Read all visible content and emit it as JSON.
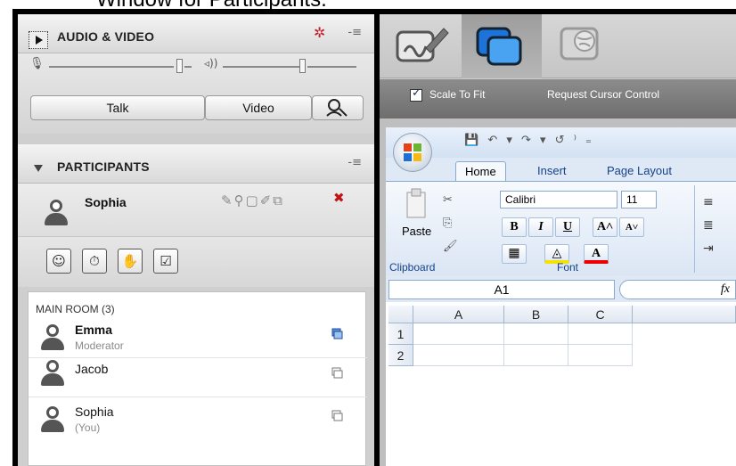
{
  "window_title": "Window for Participants.",
  "audio_video": {
    "title": "AUDIO & VIDEO",
    "talk_label": "Talk",
    "video_label": "Video"
  },
  "participants": {
    "title": "PARTICIPANTS",
    "me_name": "Sophia",
    "room_label": "MAIN ROOM (3)",
    "list": [
      {
        "name": "Emma",
        "sub": "Moderator"
      },
      {
        "name": "Jacob",
        "sub": ""
      },
      {
        "name": "Sophia",
        "sub": "(You)"
      }
    ]
  },
  "share_toolbar": {
    "scale_label": "Scale To Fit",
    "request_label": "Request Cursor Control"
  },
  "excel": {
    "tabs": [
      "Home",
      "Insert",
      "Page Layout"
    ],
    "paste_label": "Paste",
    "font_name": "Calibri",
    "font_size": "11",
    "clipboard_label": "Clipboard",
    "font_label": "Font",
    "cell_ref": "A1",
    "fx": "fx",
    "columns": [
      "A",
      "B",
      "C"
    ],
    "rows": [
      "1",
      "2"
    ]
  },
  "colors": {
    "accent_blue": "#15428b",
    "selected_tool": "#3a8de0"
  }
}
